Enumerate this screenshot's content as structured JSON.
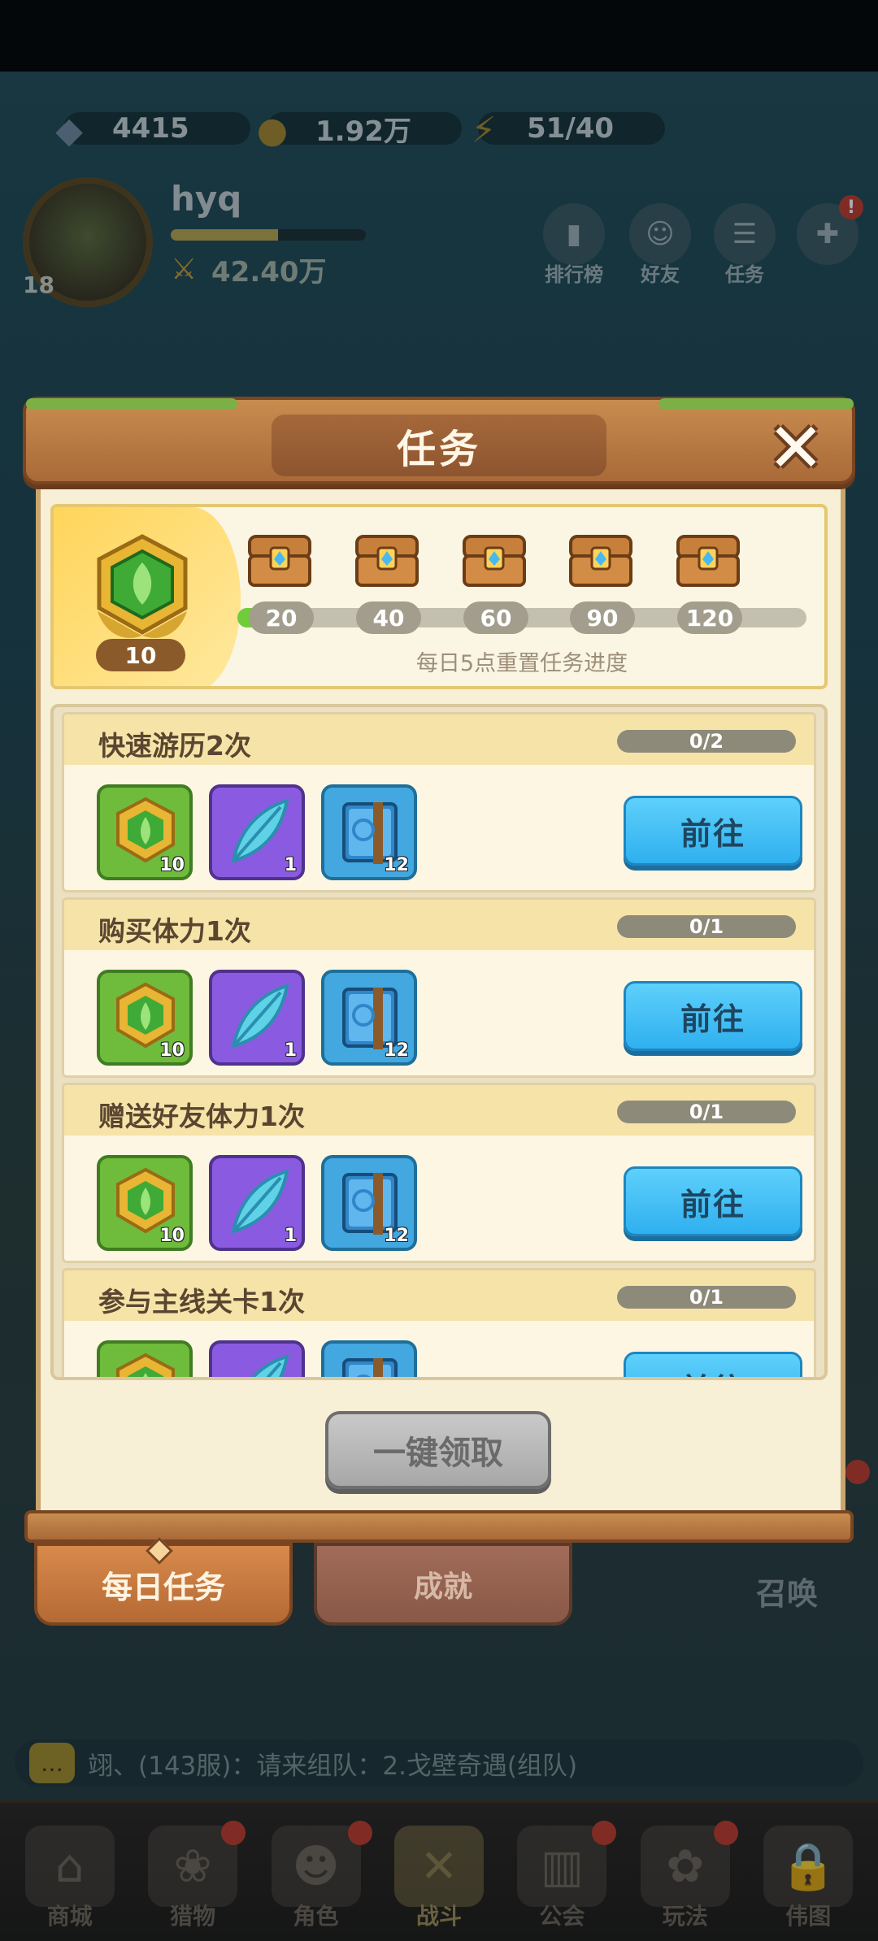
{
  "resources": {
    "gems": "4415",
    "gold": "1.92万",
    "stamina": "51/40"
  },
  "player": {
    "name": "hyq",
    "level": "18",
    "power": "42.40万",
    "xp_fraction": 0.55
  },
  "top_nav": {
    "rank": "排行榜",
    "friends": "好友",
    "tasks": "任务",
    "more_badge": "!"
  },
  "panel": {
    "title": "任务",
    "close": "✕",
    "activity_points": "10",
    "progress_fraction": 0.065,
    "milestones": [
      "20",
      "40",
      "60",
      "90",
      "120"
    ],
    "reset_note": "每日5点重置任务进度"
  },
  "tasks": [
    {
      "title": "快速游历2次",
      "progress": "0/2",
      "rewards": [
        "10",
        "1",
        "12"
      ],
      "button": "前往"
    },
    {
      "title": "购买体力1次",
      "progress": "0/1",
      "rewards": [
        "10",
        "1",
        "12"
      ],
      "button": "前往"
    },
    {
      "title": "赠送好友体力1次",
      "progress": "0/1",
      "rewards": [
        "10",
        "1",
        "12"
      ],
      "button": "前往"
    },
    {
      "title": "参与主线关卡1次",
      "progress": "0/1",
      "rewards": [
        "",
        "",
        ""
      ],
      "button": "前往"
    }
  ],
  "claim_all": "一键领取",
  "tabs": {
    "daily": "每日任务",
    "achievements": "成就"
  },
  "side": {
    "summon": "召唤"
  },
  "chat": {
    "message": "翊、(143服)：请来组队：2.戈壁奇遇(组队)"
  },
  "bottom_nav": {
    "shop": "商城",
    "pets": "猎物",
    "role": "角色",
    "battle": "战斗",
    "guild": "公会",
    "play": "玩法",
    "locked": "伟图"
  },
  "colors": {
    "go_button": "#2fb0ef",
    "progress_fill": "#70cc3a",
    "panel_wood": "#a96a38"
  }
}
